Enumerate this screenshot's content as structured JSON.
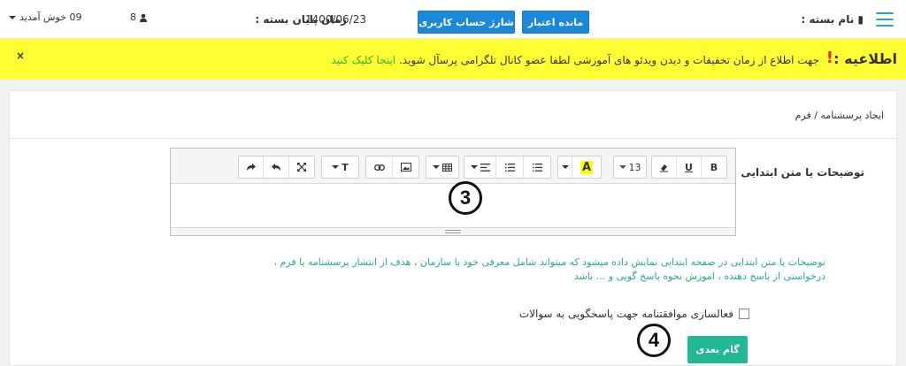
{
  "topbar": {
    "package_name_label": "نام بسته :",
    "end_date_label": "زمان پایان بسته :",
    "end_date_value": "1400/06/23",
    "remaining_credit_button": "مانده اعتبار",
    "charge_account_button": "شارژ حساب کاربری",
    "user_count": "8",
    "welcome_text": "09 خوش آمدید"
  },
  "notice": {
    "title": "اطلاعیه :",
    "excl": "!",
    "message": "جهت اطلاع از زمان تخفیفات و دیدن ویدئو های آموزشی لطفا عضو کانال تلگرامی پرسآل شوید.",
    "link_text": "اینجا کلیک کنید",
    "close_glyph": "×"
  },
  "page": {
    "breadcrumb": "ایجاد پرسشنامه / فرم",
    "field_label": "توضیحات یا متن ابتدایی",
    "help_text": "توضیحات یا متن ابتدایی در صفحه ابتدایی نمایش داده میشود که میتواند شامل معرفی خود یا سازمان ، هدف از انتشار پرسشنامه یا فرم ، درخواستی از پاسخ دهنده ، اموزش نحوه پاسخ گویی و ... باشد",
    "agree_label": "فعالسازی موافقتنامه جهت پاسخگویی به سوالات",
    "next_button": "گام بعدی"
  },
  "editor": {
    "font_size": "13",
    "bold": "B",
    "underline": "U",
    "text_color": "A",
    "style": "T",
    "accent_color": "#ffff00"
  },
  "markers": {
    "three": "3",
    "four": "4"
  },
  "colors": {
    "primary_button": "#1e88d8",
    "notice_bg": "#ffff33",
    "next_button": "#21b994",
    "help_text": "#2aaa96"
  }
}
